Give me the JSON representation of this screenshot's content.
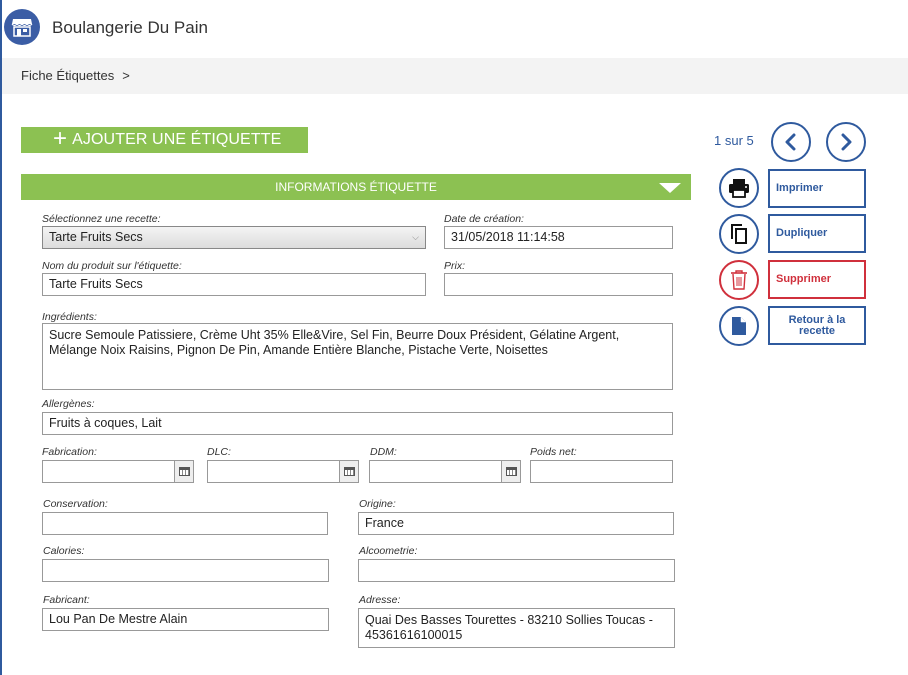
{
  "app": {
    "title": "Boulangerie Du Pain"
  },
  "breadcrumb": {
    "item": "Fiche Étiquettes",
    "separator": ">"
  },
  "add_button": {
    "label": "AJOUTER UNE ÉTIQUETTE"
  },
  "section": {
    "title": "INFORMATIONS ÉTIQUETTE"
  },
  "form": {
    "recipe": {
      "label": "Sélectionnez une recette:",
      "value": "Tarte Fruits Secs"
    },
    "created": {
      "label": "Date de création:",
      "value": "31/05/2018 11:14:58"
    },
    "product_name": {
      "label": "Nom du produit sur l'étiquette:",
      "value": "Tarte Fruits Secs"
    },
    "price": {
      "label": "Prix:",
      "value": ""
    },
    "ingredients": {
      "label": "Ingrédients:",
      "value": "Sucre Semoule Patissiere, Crème Uht 35% Elle&Vire, Sel Fin, Beurre Doux Président, Gélatine Argent, Mélange Noix Raisins, Pignon De Pin, Amande Entière Blanche, Pistache Verte, Noisettes"
    },
    "allergens": {
      "label": "Allergènes:",
      "value": "Fruits à coques, Lait"
    },
    "fabrication": {
      "label": "Fabrication:",
      "value": ""
    },
    "dlc": {
      "label": "DLC:",
      "value": ""
    },
    "ddm": {
      "label": "DDM:",
      "value": ""
    },
    "net_weight": {
      "label": "Poids net:",
      "value": ""
    },
    "conservation": {
      "label": "Conservation:",
      "value": ""
    },
    "origin": {
      "label": "Origine:",
      "value": "France"
    },
    "calories": {
      "label": "Calories:",
      "value": ""
    },
    "alcohol": {
      "label": "Alcoometrie:",
      "value": ""
    },
    "manufacturer": {
      "label": "Fabricant:",
      "value": "Lou Pan De Mestre Alain"
    },
    "address": {
      "label": "Adresse:",
      "value": "Quai Des Basses Tourettes - 83210 Sollies Toucas - 45361616100015"
    }
  },
  "pager": {
    "text": "1 sur 5"
  },
  "actions": {
    "print": "Imprimer",
    "duplicate": "Dupliquer",
    "delete": "Supprimer",
    "back": "Retour à la recette"
  },
  "icons": {
    "logo": "storefront-icon",
    "prev": "chevron-left-icon",
    "next": "chevron-right-icon",
    "print": "printer-icon",
    "duplicate": "copy-icon",
    "delete": "trash-icon",
    "back": "document-icon",
    "calendar": "calendar-icon",
    "add": "plus-icon",
    "collapse": "triangle-down-icon"
  },
  "colors": {
    "brand_blue": "#2f5a9e",
    "green": "#8cc152",
    "danger": "#d0303c"
  }
}
